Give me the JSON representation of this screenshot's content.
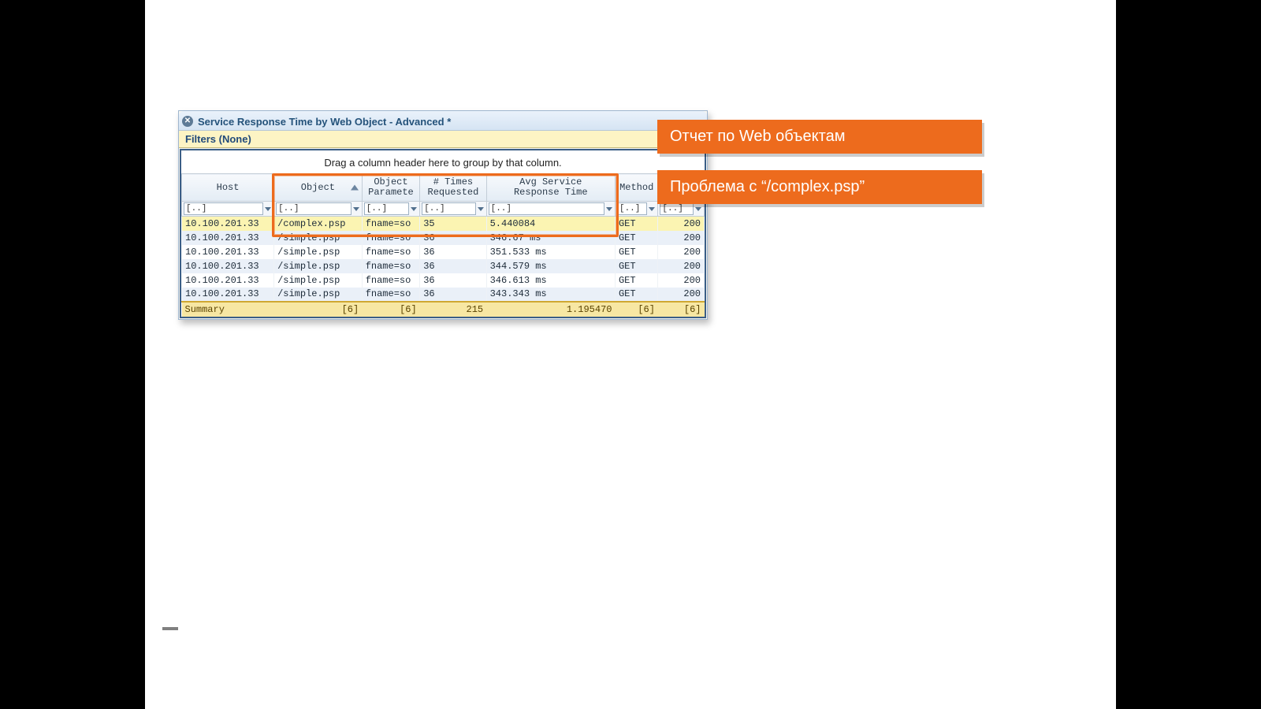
{
  "tab": {
    "title": "Service Response Time by Web Object - Advanced *"
  },
  "filters": {
    "label": "Filters (None)"
  },
  "group_hint": "Drag a column header here to group by that column.",
  "columns": {
    "host": "Host",
    "object": "Object",
    "parameters": "Object Parameters",
    "times": "# Times Requested",
    "avg": "Avg Service Response Time",
    "method": "Method",
    "status": ""
  },
  "filter_token": "[..]",
  "rows": [
    {
      "host": "10.100.201.33",
      "object": "/complex.psp",
      "params": "fname=so",
      "times": "35",
      "avg": "5.440084",
      "method": "GET",
      "status": "200",
      "hl": true
    },
    {
      "host": "10.100.201.33",
      "object": "/simple.psp",
      "params": "fname=so",
      "times": "36",
      "avg": "346.67 ms",
      "method": "GET",
      "status": "200"
    },
    {
      "host": "10.100.201.33",
      "object": "/simple.psp",
      "params": "fname=so",
      "times": "36",
      "avg": "351.533 ms",
      "method": "GET",
      "status": "200"
    },
    {
      "host": "10.100.201.33",
      "object": "/simple.psp",
      "params": "fname=so",
      "times": "36",
      "avg": "344.579 ms",
      "method": "GET",
      "status": "200"
    },
    {
      "host": "10.100.201.33",
      "object": "/simple.psp",
      "params": "fname=so",
      "times": "36",
      "avg": "346.613 ms",
      "method": "GET",
      "status": "200"
    },
    {
      "host": "10.100.201.33",
      "object": "/simple.psp",
      "params": "fname=so",
      "times": "36",
      "avg": "343.343 ms",
      "method": "GET",
      "status": "200"
    }
  ],
  "summary": {
    "label": "Summary",
    "object": "[6]",
    "params": "[6]",
    "times": "215",
    "avg": "1.195470",
    "method": "[6]",
    "status": "[6]"
  },
  "callouts": {
    "c1": "Отчет по Web объектам",
    "c2": "Проблема с “/complex.psp”"
  }
}
